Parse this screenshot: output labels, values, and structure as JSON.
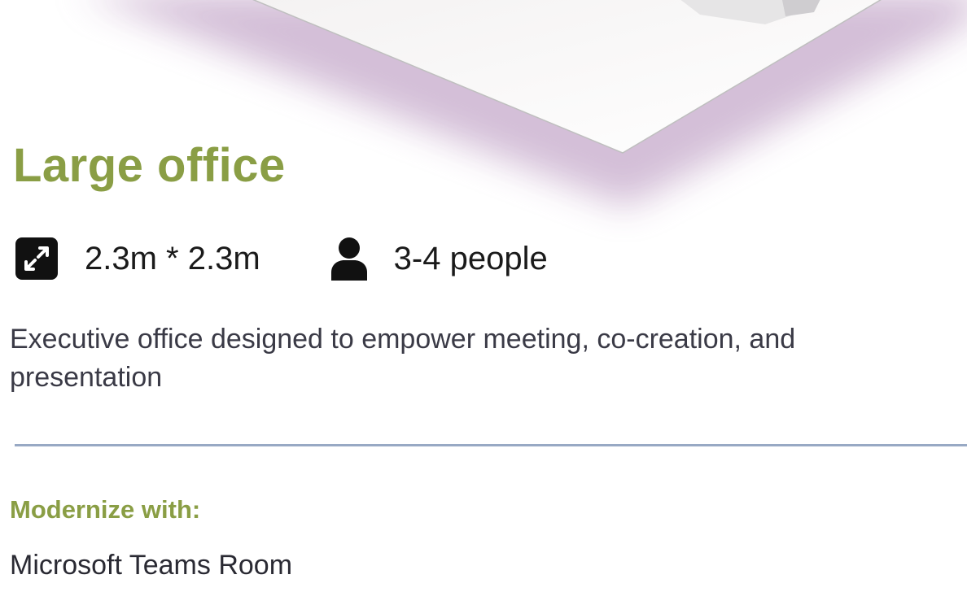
{
  "room": {
    "title": "Large office",
    "size": {
      "icon": "expand-arrows-icon",
      "text": "2.3m * 2.3m"
    },
    "capacity": {
      "icon": "person-icon",
      "text": "3-4 people"
    },
    "description": "Executive office designed to empower meeting, co-creation, and presentation"
  },
  "modernize": {
    "heading": "Modernize with:",
    "items": [
      "Microsoft Teams Room"
    ]
  },
  "colors": {
    "accent_green": "#8a9e45",
    "divider": "#98a9c4",
    "body_text": "#3a3a46",
    "floor_shadow": "#d8c4dc"
  }
}
